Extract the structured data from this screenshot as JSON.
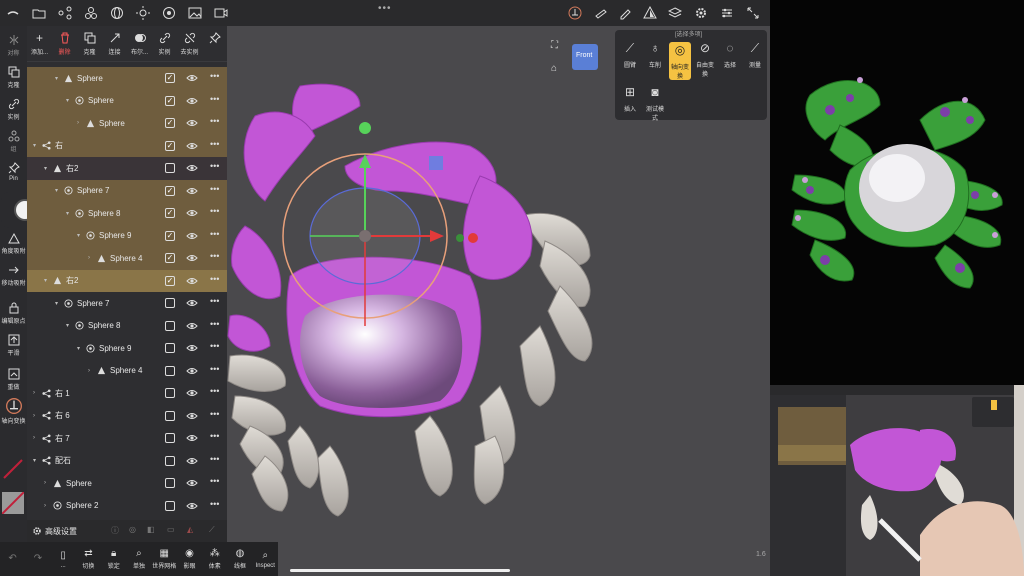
{
  "topbar": {
    "icons": [
      "menu-icon",
      "folder-icon",
      "scene-icon",
      "shape-icon",
      "globe-icon",
      "light-icon",
      "material-icon",
      "image-icon",
      "video-icon",
      "more-icon",
      "axis-icon",
      "draw-icon",
      "pen-icon",
      "solid-icon",
      "layers-icon",
      "settings-icon",
      "sliders-icon",
      "expand-icon"
    ]
  },
  "outliner_toolbar": [
    {
      "label": "添加...",
      "icon": "plus-icon"
    },
    {
      "label": "删除",
      "icon": "trash-icon",
      "color": "#ff5a5a"
    },
    {
      "label": "克隆",
      "icon": "clone-icon"
    },
    {
      "label": "连接",
      "icon": "connect-icon"
    },
    {
      "label": "布尔...",
      "icon": "boolean-icon"
    },
    {
      "label": "实例",
      "icon": "instance-icon"
    },
    {
      "label": "去实例",
      "icon": "uninstance-icon"
    },
    {
      "label": "",
      "icon": "pin-icon"
    }
  ],
  "rows": [
    {
      "label": "Sphere",
      "indent": 2,
      "icon": "mesh-icon",
      "checked": true,
      "style": "hl"
    },
    {
      "label": "Sphere",
      "indent": 3,
      "icon": "group-icon",
      "checked": true,
      "style": "hl"
    },
    {
      "label": "Sphere",
      "indent": 4,
      "icon": "mesh-icon",
      "checked": true,
      "style": "hl"
    },
    {
      "label": "右",
      "indent": 0,
      "icon": "node-icon",
      "checked": true,
      "style": "hl"
    },
    {
      "label": "右2",
      "indent": 1,
      "icon": "mesh-icon",
      "checked": false,
      "style": "dark"
    },
    {
      "label": "Sphere 7",
      "indent": 2,
      "icon": "group-icon",
      "checked": true,
      "style": "hl"
    },
    {
      "label": "Sphere 8",
      "indent": 3,
      "icon": "group-icon",
      "checked": true,
      "style": "hl"
    },
    {
      "label": "Sphere 9",
      "indent": 4,
      "icon": "group-icon",
      "checked": true,
      "style": "hl"
    },
    {
      "label": "Sphere 4",
      "indent": 5,
      "icon": "mesh-icon",
      "checked": true,
      "style": "hl"
    },
    {
      "label": "右2",
      "indent": 1,
      "icon": "mesh-icon",
      "checked": true,
      "style": "sel"
    },
    {
      "label": "Sphere 7",
      "indent": 2,
      "icon": "group-icon",
      "checked": false,
      "style": ""
    },
    {
      "label": "Sphere 8",
      "indent": 3,
      "icon": "group-icon",
      "checked": false,
      "style": ""
    },
    {
      "label": "Sphere 9",
      "indent": 4,
      "icon": "group-icon",
      "checked": false,
      "style": ""
    },
    {
      "label": "Sphere 4",
      "indent": 5,
      "icon": "mesh-icon",
      "checked": false,
      "style": ""
    },
    {
      "label": "右 1",
      "indent": 0,
      "icon": "node-icon",
      "checked": false,
      "style": ""
    },
    {
      "label": "右 6",
      "indent": 0,
      "icon": "node-icon",
      "checked": false,
      "style": ""
    },
    {
      "label": "右 7",
      "indent": 0,
      "icon": "node-icon",
      "checked": false,
      "style": ""
    },
    {
      "label": "配石",
      "indent": 0,
      "icon": "node-icon",
      "checked": false,
      "style": ""
    },
    {
      "label": "Sphere",
      "indent": 1,
      "icon": "mesh-icon",
      "checked": false,
      "style": ""
    },
    {
      "label": "Sphere 2",
      "indent": 1,
      "icon": "group-icon",
      "checked": false,
      "style": ""
    }
  ],
  "outliner_footer": {
    "label": "高级设置"
  },
  "rail": [
    {
      "label": "对称"
    },
    {
      "label": "克隆"
    },
    {
      "label": "实例"
    },
    {
      "label": "组"
    },
    {
      "label": "Pin"
    },
    {
      "label": "角度吸附"
    },
    {
      "label": "移动吸附"
    },
    {
      "label": "编辑原点"
    },
    {
      "label": "平滑"
    },
    {
      "label": "重做"
    },
    {
      "label": "轴向变换"
    }
  ],
  "bottombar": [
    {
      "label": "",
      "icon": "undo-icon"
    },
    {
      "label": "",
      "icon": "redo-icon"
    },
    {
      "label": "...",
      "icon": "phone-icon"
    },
    {
      "label": "切换",
      "icon": "toggle-icon"
    },
    {
      "label": "锁定",
      "icon": "lock-icon"
    },
    {
      "label": "单独",
      "icon": "search-icon"
    },
    {
      "label": "世界网格",
      "icon": "grid-icon"
    },
    {
      "label": "影眼",
      "icon": "eye-icon"
    },
    {
      "label": "体素",
      "icon": "voxel-icon"
    },
    {
      "label": "线框",
      "icon": "wireframe-icon"
    },
    {
      "label": "Inspect",
      "icon": "inspect-icon"
    }
  ],
  "toolpop": {
    "header": "[选择多项]",
    "tools": [
      {
        "label": "圆臂",
        "icon": "curve-icon"
      },
      {
        "label": "车削",
        "icon": "lathe-icon"
      },
      {
        "label": "轴向变换",
        "icon": "gizmo-icon",
        "active": true
      },
      {
        "label": "自由变换",
        "icon": "free-transform-icon"
      },
      {
        "label": "选择",
        "icon": "select-icon"
      },
      {
        "label": "测量",
        "icon": "measure-icon"
      },
      {
        "label": "插入",
        "icon": "insert-icon"
      },
      {
        "label": "测试模式",
        "icon": "camera-icon"
      }
    ]
  },
  "viewcube": {
    "label": "Front"
  },
  "colors": {
    "accent": "#f5c242",
    "crab": "#c256d6",
    "selection": "#8a7548"
  }
}
